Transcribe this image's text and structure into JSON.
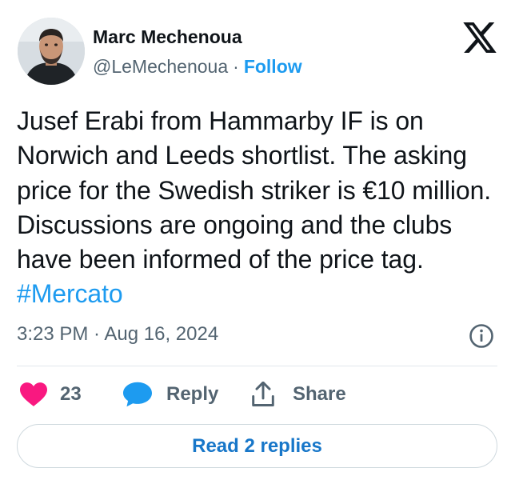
{
  "author": {
    "name": "Marc Mechenoua",
    "handle": "@LeMechenoua",
    "separator": "·",
    "follow_label": "Follow"
  },
  "tweet": {
    "text_before_hashtag": "Jusef Erabi from Hammarby IF is on Norwich and Leeds shortlist. The asking price for the Swedish striker is €10 million. Discussions are ongoing and the clubs have been informed of the price tag. ",
    "hashtag": "#Mercato",
    "timestamp": "3:23 PM · Aug 16, 2024"
  },
  "actions": {
    "like_count": "23",
    "reply_label": "Reply",
    "share_label": "Share"
  },
  "read_replies_label": "Read 2 replies",
  "icons": {
    "brand": "x-logo-icon",
    "info": "info-icon",
    "like": "heart-icon",
    "reply": "speech-bubble-icon",
    "share": "share-upload-icon"
  },
  "colors": {
    "link": "#1d9bf0",
    "like": "#f91880",
    "reply": "#1d9bf0",
    "muted": "#536471",
    "text": "#0f1419",
    "read_replies": "#1877c9"
  }
}
